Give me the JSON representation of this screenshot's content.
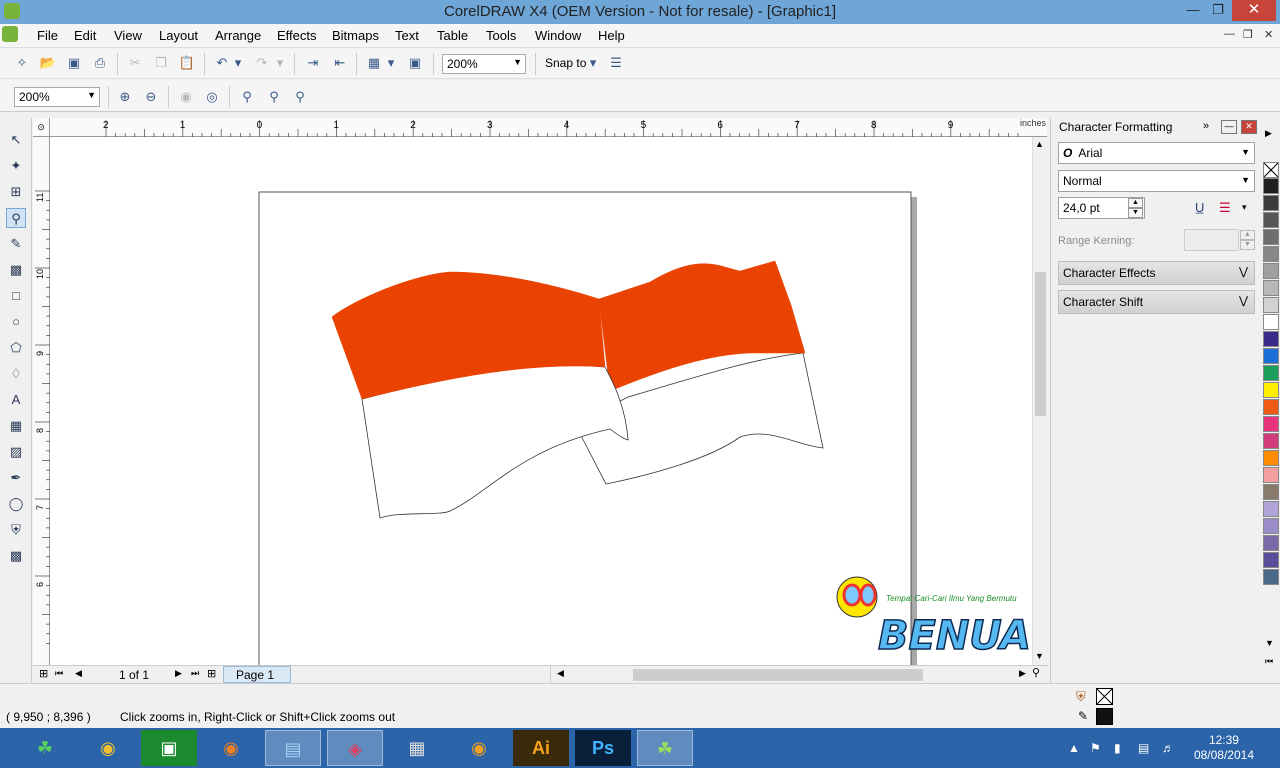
{
  "window": {
    "title": "CorelDRAW X4 (OEM Version - Not for resale) - [Graphic1]",
    "min": "—",
    "max": "❐",
    "close": "✕"
  },
  "menu": [
    {
      "label": "File"
    },
    {
      "label": "Edit"
    },
    {
      "label": "View"
    },
    {
      "label": "Layout"
    },
    {
      "label": "Arrange"
    },
    {
      "label": "Effects"
    },
    {
      "label": "Bitmaps"
    },
    {
      "label": "Text"
    },
    {
      "label": "Table"
    },
    {
      "label": "Tools"
    },
    {
      "label": "Window"
    },
    {
      "label": "Help"
    }
  ],
  "toolbar": {
    "zoom_level": "200%",
    "snap_to": "Snap to"
  },
  "propertybar": {
    "zoom_level": "200%"
  },
  "rulers": {
    "unit": "inches",
    "h_ticks": [
      "2",
      "1",
      "0",
      "1",
      "2",
      "3",
      "4",
      "5",
      "6",
      "7",
      "8",
      "9"
    ],
    "v_ticks": [
      "11",
      "10",
      "9",
      "8",
      "7",
      "6"
    ]
  },
  "docker": {
    "title": "Character Formatting",
    "font": "Arial",
    "style": "Normal",
    "size": "24,0 pt",
    "range_kerning_label": "Range Kerning:",
    "sections": [
      {
        "label": "Character Effects"
      },
      {
        "label": "Character Shift"
      }
    ]
  },
  "page_nav": {
    "page_count": "1 of 1",
    "page_tab": "Page 1"
  },
  "status": {
    "coords": "( 9,950 ; 8,396 )",
    "hint": "Click zooms in, Right-Click or Shift+Click zooms out"
  },
  "palette_colors": [
    "#1f1f1f",
    "#3b3b3b",
    "#555555",
    "#6e6e6e",
    "#878787",
    "#a0a0a0",
    "#b9b9b9",
    "#d2d2d2",
    "#ffffff",
    "#3a2a8a",
    "#1c6fd6",
    "#1aa05a",
    "#ffee00",
    "#f05a14",
    "#e8347e",
    "#d23c7a",
    "#ff8c00",
    "#f5a0a0",
    "#8a7a6a",
    "#b0a4d8",
    "#9a8cc8",
    "#7a6aaa",
    "#5a4a9a",
    "#4a6a8a"
  ],
  "watermark": {
    "tagline": "Tempat Cari-Cari Ilmu Yang Bermutu",
    "brand": "BENUA ILMU"
  },
  "flag": {
    "top_color": "#ea4200",
    "bottom_color": "#ffffff"
  },
  "taskbar": {
    "apps": [
      {
        "label": "☘"
      },
      {
        "label": "◉"
      },
      {
        "label": "▣"
      },
      {
        "label": "◉"
      },
      {
        "label": "▤"
      },
      {
        "label": "◈"
      },
      {
        "label": "▦"
      },
      {
        "label": "◉"
      },
      {
        "label": "Ai"
      },
      {
        "label": "Ps"
      },
      {
        "label": "☘"
      }
    ]
  },
  "clock": {
    "time": "12:39",
    "date": "08/08/2014"
  }
}
